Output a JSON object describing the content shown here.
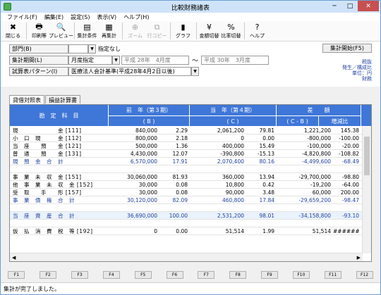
{
  "window": {
    "title": "比較財務諸表",
    "min": "─",
    "max": "□",
    "close": "✕"
  },
  "menu": [
    "ファイル(F)",
    "編集(E)",
    "設定(S)",
    "表示(V)",
    "ヘルプ(H)"
  ],
  "toolbar": [
    {
      "label": "閉じる",
      "icon": "close-icon",
      "glyph": "✖",
      "disabled": false
    },
    {
      "label": "印刷等",
      "icon": "printer-icon",
      "glyph": "🖶",
      "disabled": false
    },
    {
      "label": "プレビュー",
      "icon": "preview-icon",
      "glyph": "🔍",
      "disabled": false
    },
    {
      "label": "集計条件",
      "icon": "conditions-icon",
      "glyph": "▤",
      "disabled": false
    },
    {
      "label": "再集計",
      "icon": "recalc-icon",
      "glyph": "▦",
      "disabled": false
    },
    {
      "label": "ズーム",
      "icon": "zoom-icon",
      "glyph": "⊕",
      "disabled": true
    },
    {
      "label": "行コピー",
      "icon": "row-copy-icon",
      "glyph": "⧉",
      "disabled": true
    },
    {
      "label": "グラフ",
      "icon": "graph-icon",
      "glyph": "▮",
      "disabled": false
    },
    {
      "label": "金額切替",
      "icon": "amount-switch-icon",
      "glyph": "¥",
      "disabled": false
    },
    {
      "label": "比率切替",
      "icon": "ratio-switch-icon",
      "glyph": "%",
      "disabled": false
    },
    {
      "label": "ヘルプ",
      "icon": "help-icon",
      "glyph": "?",
      "disabled": false
    }
  ],
  "form": {
    "dept_label": "部門(B)",
    "dept_value": "",
    "dept_name": "指定なし",
    "period_label": "集計期間(L)",
    "period_mode": "月度指定",
    "period_from": "平成 28年　4月度",
    "period_to": "平成 30年　3月度",
    "pattern_label": "試算表パターン(I)",
    "pattern_value": "医療法人会計基準(平成28年4月2日以後)",
    "pattern_button": "集計開始(F5)",
    "legend": [
      "税抜",
      "発生／構成比",
      "単位：円",
      "財務"
    ]
  },
  "tabs": [
    "貸借対照表",
    "損益計算書"
  ],
  "table": {
    "headers": {
      "account": "勘　定　科　目",
      "prev": "前　年（第３期）",
      "prev_sub": "( B )",
      "curr": "当　年（第４期）",
      "curr_sub": "( C )",
      "diff": "差　　額",
      "diff_sub": "( C - B )",
      "rate": "増減比"
    },
    "rows": [
      {
        "name": "現　　　　　　　金 [111]",
        "prev": "840,000",
        "prev_r": "2.29",
        "curr": "2,061,200",
        "curr_r": "79.81",
        "diff": "1,221,200",
        "rate": "145.38",
        "total": false
      },
      {
        "name": "小　口　現　　　金 [112]",
        "prev": "800,000",
        "prev_r": "2.18",
        "curr": "0",
        "curr_r": "0.00",
        "diff": "-800,000",
        "rate": "-100.00",
        "total": false
      },
      {
        "name": "当　座　　預　　金 [121]",
        "prev": "500,000",
        "prev_r": "1.36",
        "curr": "400,000",
        "curr_r": "15.49",
        "diff": "-100,000",
        "rate": "-20.00",
        "total": false
      },
      {
        "name": "普　通　　預　　金 [131]",
        "prev": "4,430,000",
        "prev_r": "12.07",
        "curr": "-390,800",
        "curr_r": "-15.13",
        "diff": "-4,820,800",
        "rate": "-108.82",
        "total": false
      },
      {
        "name": "現　預　金　合　計",
        "prev": "6,570,000",
        "prev_r": "17.91",
        "curr": "2,070,400",
        "curr_r": "80.16",
        "diff": "-4,499,600",
        "rate": "-68.49",
        "total": true
      },
      {
        "name": "",
        "prev": "",
        "prev_r": "",
        "curr": "",
        "curr_r": "",
        "diff": "",
        "rate": "",
        "total": false
      },
      {
        "name": "事　業　未　収　金 [151]",
        "prev": "30,060,000",
        "prev_r": "81.93",
        "curr": "360,000",
        "curr_r": "13.94",
        "diff": "-29,700,000",
        "rate": "-98.80",
        "total": false
      },
      {
        "name": "他　事　業　未　収　金 [152]",
        "prev": "30,000",
        "prev_r": "0.08",
        "curr": "10,800",
        "curr_r": "0.42",
        "diff": "-19,200",
        "rate": "-64.00",
        "total": false
      },
      {
        "name": "受　取　　手　　形 [157]",
        "prev": "30,000",
        "prev_r": "0.08",
        "curr": "90,000",
        "curr_r": "3.48",
        "diff": "60,000",
        "rate": "200.00",
        "total": false
      },
      {
        "name": "事　業　債　権　合　計",
        "prev": "30,120,000",
        "prev_r": "82.09",
        "curr": "460,800",
        "curr_r": "17.84",
        "diff": "-29,659,200",
        "rate": "-98.47",
        "total": true
      },
      {
        "name": "",
        "prev": "",
        "prev_r": "",
        "curr": "",
        "curr_r": "",
        "diff": "",
        "rate": "",
        "total": false
      },
      {
        "name": "当　座　資　産　合　計",
        "prev": "36,690,000",
        "prev_r": "100.00",
        "curr": "2,531,200",
        "curr_r": "98.01",
        "diff": "-34,158,800",
        "rate": "-93.10",
        "total": true
      },
      {
        "name": "",
        "prev": "",
        "prev_r": "",
        "curr": "",
        "curr_r": "",
        "diff": "",
        "rate": "",
        "total": false
      },
      {
        "name": "仮　払　消　費　税　等 [192]",
        "prev": "0",
        "prev_r": "0.00",
        "curr": "51,514",
        "curr_r": "1.99",
        "diff": "51,514",
        "rate": "######",
        "total": false
      }
    ]
  },
  "fkeys": [
    "F1",
    "F2",
    "F3",
    "F4",
    "F5",
    "F6",
    "F7",
    "F8",
    "F9",
    "F10",
    "F11",
    "F12"
  ],
  "status": "集計が完了しました。"
}
